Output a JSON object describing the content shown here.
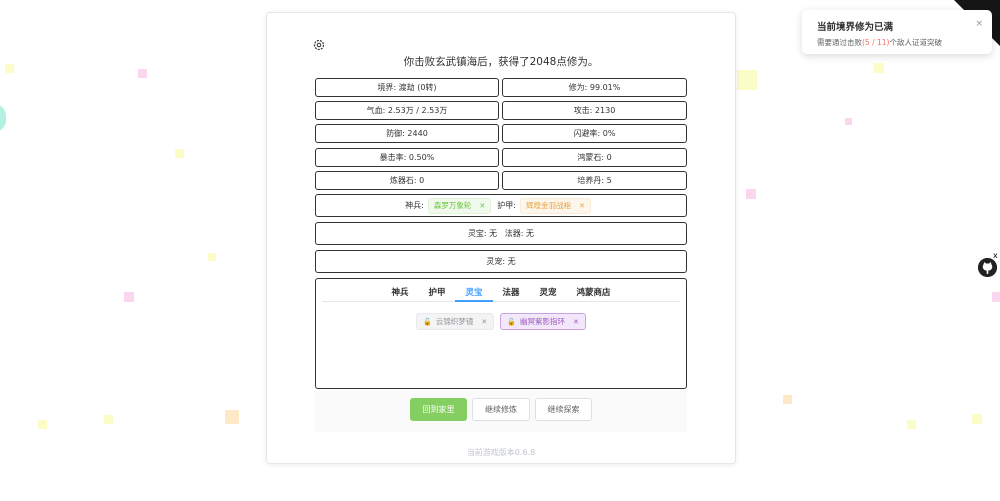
{
  "colors": {
    "accent": "#409eff",
    "green_button": "#85ce61",
    "border": "#333333",
    "highlight_red": "#f56c6c"
  },
  "headline": "你击败玄武镇海后，获得了2048点修为。",
  "stats": [
    "境界: 渡劫 (0转)",
    "修为: 99.01%",
    "气血: 2.53万 / 2.53万",
    "攻击: 2130",
    "防御: 2440",
    "闪避率: 0%",
    "暴击率: 0.50%",
    "鸿蒙石: 0",
    "炼器石: 0",
    "培养丹: 5"
  ],
  "equipment": {
    "weapon_label": "神兵:",
    "weapon_value": "森罗万象轮",
    "armor_label": "护甲:",
    "armor_value": "辉煌金羽战袍",
    "remove_icon": "close-icon"
  },
  "treasure_line": "灵宝: 无   法器: 无",
  "pet_line": "灵宠: 无",
  "tabs": [
    "神兵",
    "护甲",
    "灵宝",
    "法器",
    "灵宠",
    "鸿蒙商店"
  ],
  "active_tab": "灵宝",
  "inventory": [
    {
      "name": "云锦织梦镜",
      "style": "gray",
      "icon": "lock-icon"
    },
    {
      "name": "幽冥紫影指环",
      "style": "purple",
      "icon": "lock-icon"
    }
  ],
  "buttons": {
    "home": "回到家里",
    "cultivate": "继续修炼",
    "explore": "继续探索"
  },
  "version": "当前游戏版本0.6.8",
  "notification": {
    "title": "当前境界修为已满",
    "desc_prefix": "需要通过击败",
    "desc_count": "(5 / 11)",
    "desc_suffix": "个敌人证道突破",
    "close": "×"
  },
  "github_close": "x"
}
